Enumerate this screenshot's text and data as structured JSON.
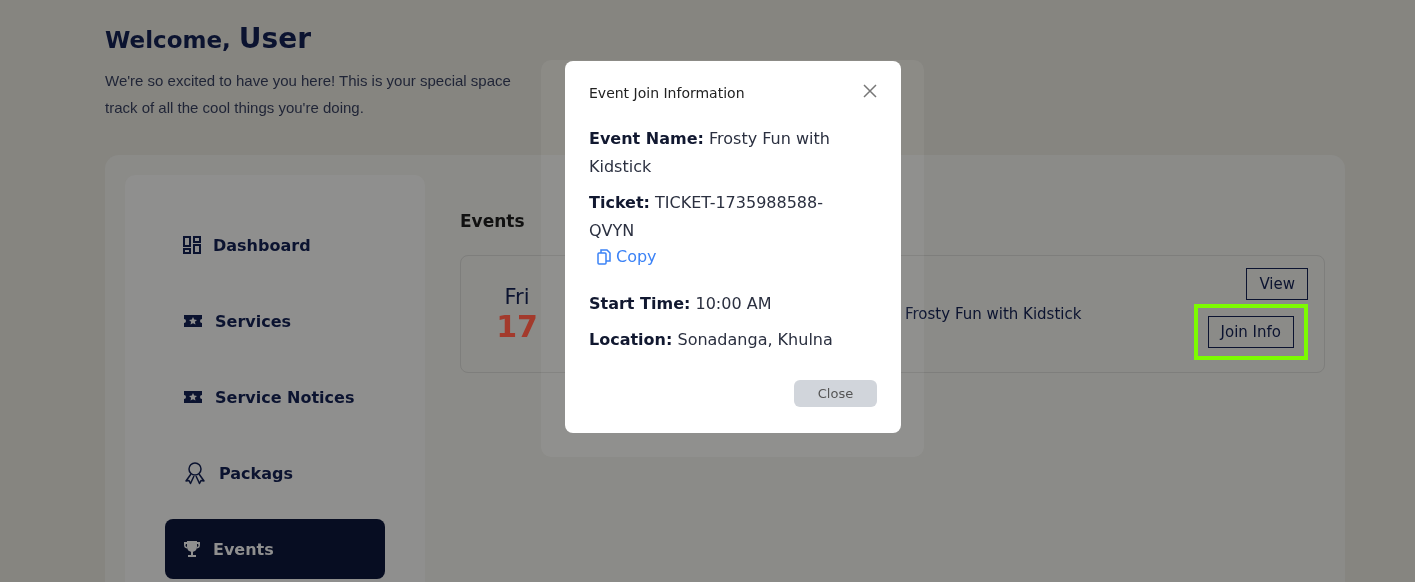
{
  "welcome": {
    "greeting": "Welcome,",
    "name": "User",
    "intro_lines": [
      "We're so excited to have you here! This is your special space",
      "track of all the cool things you're doing."
    ]
  },
  "sidebar": {
    "items": [
      {
        "label": "Dashboard",
        "kind": "grid",
        "selected": false
      },
      {
        "label": "Services",
        "kind": "ticket",
        "selected": false
      },
      {
        "label": "Service Notices",
        "kind": "ticket",
        "selected": false
      },
      {
        "label": "Packags",
        "kind": "award",
        "selected": false
      },
      {
        "label": "Events",
        "kind": "trophy",
        "selected": true
      }
    ]
  },
  "events": {
    "heading": "Events",
    "items": [
      {
        "weekday": "Fri",
        "day": "17",
        "title": "Frosty Fun with Kidstick",
        "buttons": [
          {
            "label": "View",
            "highlighted": false
          },
          {
            "label": "Join Info",
            "highlighted": true
          }
        ]
      }
    ]
  },
  "dialog": {
    "title": "Event Join Information",
    "fields": [
      {
        "label": "Event Name:",
        "value": "Frosty Fun with Kidstick"
      },
      {
        "label": "Ticket:",
        "value": "TICKET-1735988588-QVYN",
        "copy": "Copy"
      },
      {
        "label": "Start Time:",
        "value": "10:00 AM"
      },
      {
        "label": "Location:",
        "value": "Sonadanga, Khulna"
      }
    ],
    "close_button": "Close"
  }
}
